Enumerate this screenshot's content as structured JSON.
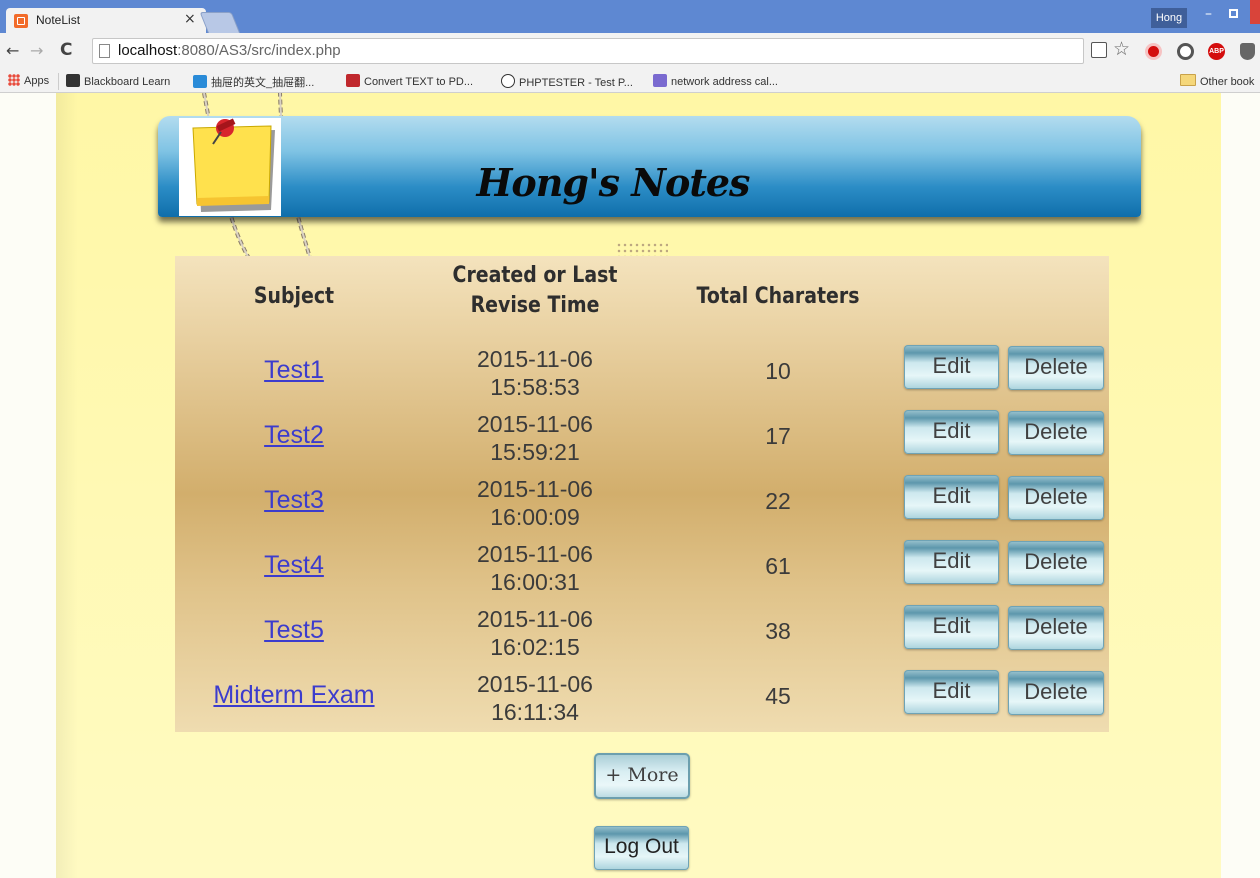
{
  "browser": {
    "tab_title": "NoteList",
    "tab_close": "×",
    "profile_name": "Hong",
    "url_host": "localhost",
    "url_rest": ":8080/AS3/src/index.php",
    "bookmarks": [
      {
        "label": "Apps"
      },
      {
        "label": "Blackboard Learn"
      },
      {
        "label": "抽屉的英文_抽屉翻..."
      },
      {
        "label": "Convert TEXT to PD..."
      },
      {
        "label": "PHPTESTER - Test P..."
      },
      {
        "label": "network address cal..."
      }
    ],
    "other_bookmarks": "Other book"
  },
  "header": {
    "title": "Hong's Notes"
  },
  "table": {
    "headers": {
      "subject": "Subject",
      "time": "Created or Last Revise Time",
      "chars": "Total Charaters"
    },
    "rows": [
      {
        "subject": "Test1",
        "date": "2015-11-06",
        "time": "15:58:53",
        "chars": "10",
        "edit": "Edit",
        "delete": "Delete"
      },
      {
        "subject": "Test2",
        "date": "2015-11-06",
        "time": "15:59:21",
        "chars": "17",
        "edit": "Edit",
        "delete": "Delete"
      },
      {
        "subject": "Test3",
        "date": "2015-11-06",
        "time": "16:00:09",
        "chars": "22",
        "edit": "Edit",
        "delete": "Delete"
      },
      {
        "subject": "Test4",
        "date": "2015-11-06",
        "time": "16:00:31",
        "chars": "61",
        "edit": "Edit",
        "delete": "Delete"
      },
      {
        "subject": "Test5",
        "date": "2015-11-06",
        "time": "16:02:15",
        "chars": "38",
        "edit": "Edit",
        "delete": "Delete"
      },
      {
        "subject": "Midterm Exam",
        "date": "2015-11-06",
        "time": "16:11:34",
        "chars": "45",
        "edit": "Edit",
        "delete": "Delete"
      }
    ]
  },
  "actions": {
    "more": "+ More",
    "logout": "Log Out"
  },
  "colors": {
    "link": "#3c3ccd",
    "paper": "#fff7a6",
    "banner": "#2c8dc6"
  }
}
